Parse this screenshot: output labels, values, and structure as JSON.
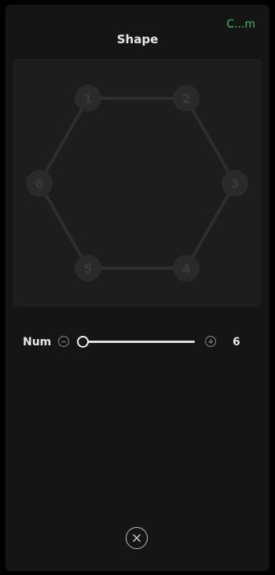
{
  "header": {
    "title": "Shape",
    "confirm_label": "C...m"
  },
  "shape": {
    "type": "hexagon",
    "nodes": [
      {
        "label": "1"
      },
      {
        "label": "2"
      },
      {
        "label": "3"
      },
      {
        "label": "4"
      },
      {
        "label": "5"
      },
      {
        "label": "6"
      }
    ],
    "node_color": "#2a2a2a",
    "edge_color": "#2e2e2e",
    "label_color": "#3a3a3a"
  },
  "controls": {
    "num_label": "Num",
    "num_value": "6",
    "slider_fraction": 0.0,
    "minus_icon": "minus-circle-icon",
    "plus_icon": "plus-circle-icon"
  },
  "footer": {
    "close_icon": "close-icon"
  },
  "colors": {
    "accent": "#3fbf5f",
    "background": "#151515",
    "panel": "#1d1d1d"
  }
}
